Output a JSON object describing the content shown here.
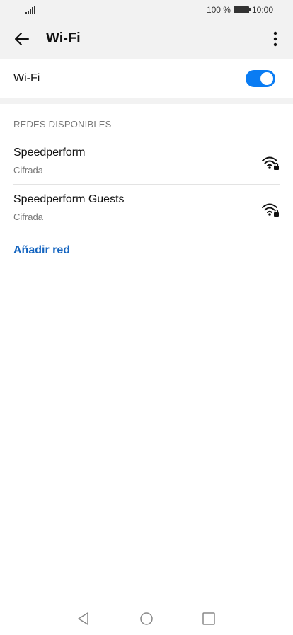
{
  "status_bar": {
    "battery_percent": "100 %",
    "time": "10:00",
    "battery_level": 1.0
  },
  "app_bar": {
    "title": "Wi-Fi"
  },
  "wifi_toggle": {
    "label": "Wi-Fi",
    "enabled": true
  },
  "section_header": "REDES DISPONIBLES",
  "networks": [
    {
      "name": "Speedperform",
      "security": "Cifrada"
    },
    {
      "name": "Speedperform Guests",
      "security": "Cifrada"
    }
  ],
  "add_network": "Añadir red",
  "colors": {
    "accent": "#0a7cf3",
    "link": "#1565c0",
    "background": "#f2f2f2"
  },
  "icons": [
    "signal-icon",
    "battery-icon",
    "back-arrow-icon",
    "more-vert-icon",
    "wifi-lock-icon",
    "nav-back-icon",
    "nav-home-icon",
    "nav-recents-icon"
  ]
}
